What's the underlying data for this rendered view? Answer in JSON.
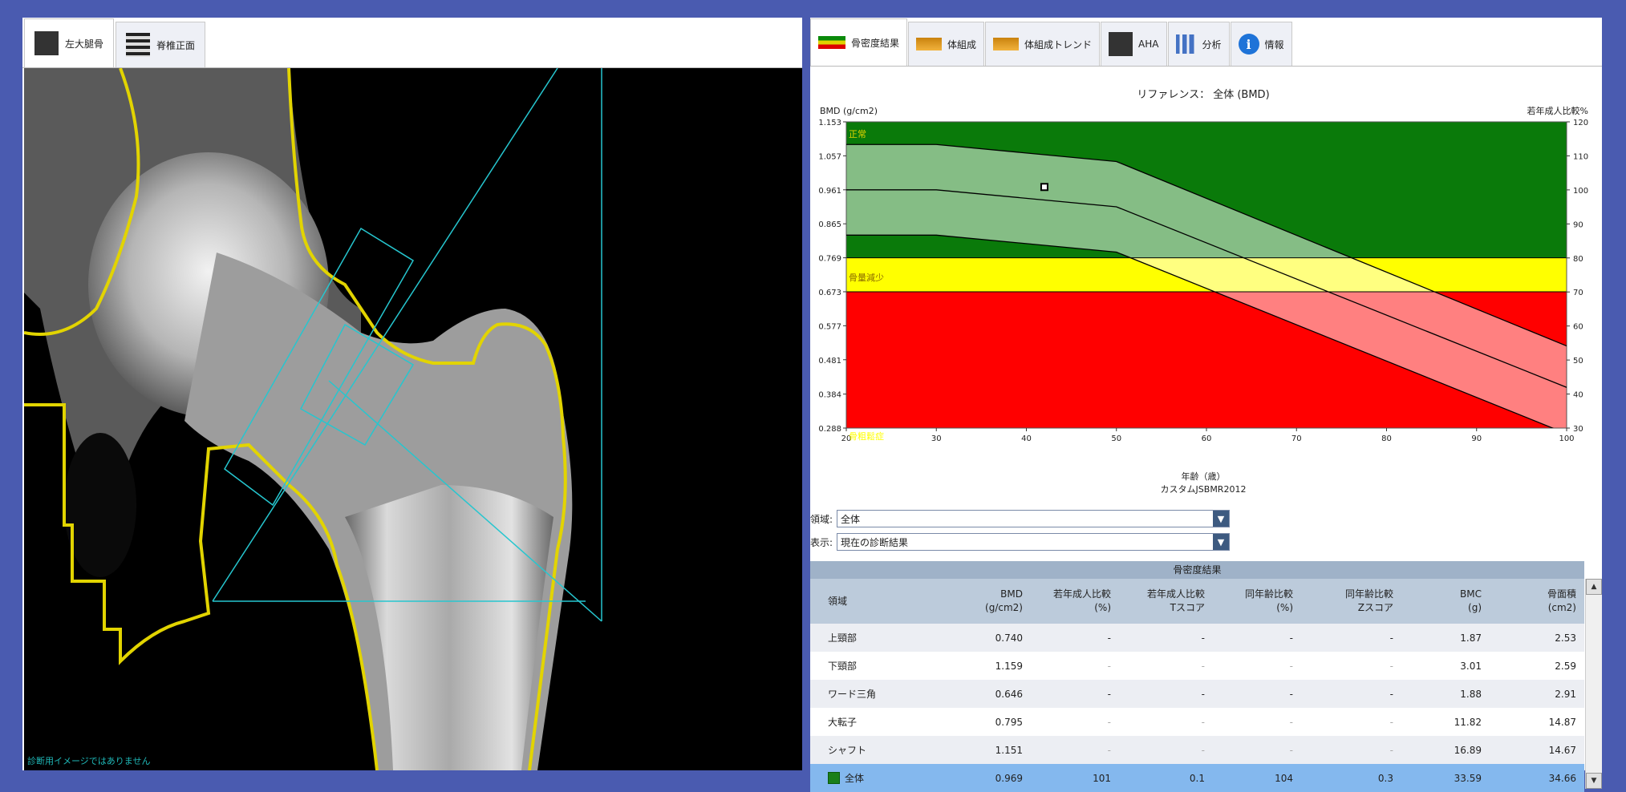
{
  "left_tabs": [
    {
      "label": "左大腿骨",
      "icon": "femur-xray-icon",
      "active": true
    },
    {
      "label": "脊椎正面",
      "icon": "spine-xray-icon",
      "active": false
    }
  ],
  "right_tabs": [
    {
      "label": "骨密度結果",
      "icon": "bmd-band-icon",
      "active": true
    },
    {
      "label": "体組成",
      "icon": "body-composition-icon",
      "active": false
    },
    {
      "label": "体組成トレンド",
      "icon": "body-composition-trend-icon",
      "active": false
    },
    {
      "label": "AHA",
      "icon": "aha-xray-icon",
      "active": false
    },
    {
      "label": "分析",
      "icon": "bar-chart-icon",
      "active": false
    },
    {
      "label": "情報",
      "icon": "info-icon",
      "active": false
    }
  ],
  "colors": {
    "normal": "#0a7a0a",
    "osteopenia": "#ffff00",
    "osteoporosis": "#ff0000",
    "age_band": "#86c386",
    "selected_row": "#84b8ee",
    "roi_lines": "#26c6cf",
    "bone_outline": "#e2d400"
  },
  "chart_data": {
    "type": "line",
    "title": "リファレンス： 全体 (BMD)",
    "ylabel": "BMD (g/cm2)",
    "y2label": "若年成人比較%",
    "xlabel": "年齢（歳）",
    "subtitle": "カスタムJSBMR2012",
    "xlim": [
      20,
      100
    ],
    "ylim": [
      0.288,
      1.153
    ],
    "y2lim": [
      30,
      120
    ],
    "x_ticks": [
      "20",
      "30",
      "40",
      "50",
      "60",
      "70",
      "80",
      "90",
      "100"
    ],
    "y_ticks": [
      "1.153",
      "1.057",
      "0.961",
      "0.865",
      "0.769",
      "0.673",
      "0.577",
      "0.481",
      "0.384",
      "0.288"
    ],
    "y2_ticks": [
      "120",
      "110",
      "100",
      "90",
      "80",
      "70",
      "60",
      "50",
      "40",
      "30"
    ],
    "zones": [
      {
        "label": "正常",
        "from": 0.769,
        "to": 1.153
      },
      {
        "label": "骨量減少",
        "from": 0.673,
        "to": 0.769
      },
      {
        "label": "骨粗鬆症",
        "from": 0.288,
        "to": 0.673
      }
    ],
    "series": [
      {
        "name": "",
        "x": [
          20,
          30,
          50,
          100
        ],
        "values": [
          1.089,
          1.089,
          1.041,
          0.52
        ]
      },
      {
        "name": "",
        "x": [
          20,
          30,
          50,
          100
        ],
        "values": [
          0.961,
          0.961,
          0.913,
          0.403
        ]
      },
      {
        "name": "",
        "x": [
          20,
          30,
          50,
          100
        ],
        "values": [
          0.833,
          0.833,
          0.785,
          0.272
        ]
      }
    ],
    "patient_point": {
      "x": 42,
      "y": 0.969
    }
  },
  "chart_labels": {
    "zone_normal": "正常",
    "zone_osteopenia": "骨量減少",
    "zone_osteoporosis": "骨粗鬆症"
  },
  "form": {
    "region_label": "領域:",
    "region_value": "全体",
    "display_label": "表示:",
    "display_value": "現在の診断結果"
  },
  "table": {
    "title": "骨密度結果",
    "headers": [
      [
        "領域"
      ],
      [
        "BMD",
        "(g/cm2)"
      ],
      [
        "若年成人比較",
        "(%)"
      ],
      [
        "若年成人比較",
        "Tスコア"
      ],
      [
        "同年齢比較",
        "(%)"
      ],
      [
        "同年齢比較",
        "Zスコア"
      ],
      [
        "BMC",
        "(g)"
      ],
      [
        "骨面積",
        "(cm2)"
      ]
    ],
    "rows": [
      {
        "cells": [
          "上頸部",
          "0.740",
          "-",
          "-",
          "-",
          "-",
          "1.87",
          "2.53"
        ],
        "dim": false
      },
      {
        "cells": [
          "下頸部",
          "1.159",
          "-",
          "-",
          "-",
          "-",
          "3.01",
          "2.59"
        ],
        "dim": true
      },
      {
        "cells": [
          "ワード三角",
          "0.646",
          "-",
          "-",
          "-",
          "-",
          "1.88",
          "2.91"
        ],
        "dim": false
      },
      {
        "cells": [
          "大転子",
          "0.795",
          "-",
          "-",
          "-",
          "-",
          "11.82",
          "14.87"
        ],
        "dim": true
      },
      {
        "cells": [
          "シャフト",
          "1.151",
          "-",
          "-",
          "-",
          "-",
          "16.89",
          "14.67"
        ],
        "dim": true
      },
      {
        "cells": [
          "全体",
          "0.969",
          "101",
          "0.1",
          "104",
          "0.3",
          "33.59",
          "34.66"
        ],
        "dim": false,
        "selected": true
      }
    ]
  },
  "xray_caption": "診断用イメージではありません"
}
